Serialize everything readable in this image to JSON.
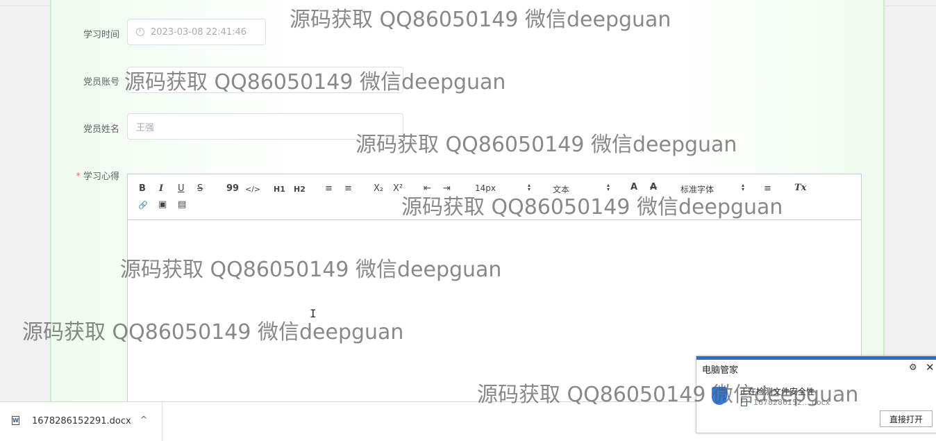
{
  "form": {
    "study_time": {
      "label": "学习时间",
      "value": "2023-03-08 22:41:46"
    },
    "member_account": {
      "label": "党员账号",
      "value": ""
    },
    "member_name": {
      "label": "党员姓名",
      "value": "王强"
    },
    "study_notes": {
      "required_mark": "*",
      "label": "学习心得"
    }
  },
  "editor": {
    "toolbar": {
      "bold": "B",
      "italic": "I",
      "underline": "U",
      "strike": "S",
      "blockquote": "99",
      "code": "</>",
      "h1": "H1",
      "h2": "H2",
      "ordered_list": "≡",
      "bullet_list": "≡",
      "subscript": "X₂",
      "superscript": "X²",
      "outdent": "⇤",
      "indent": "⇥",
      "size_picker": "14px",
      "header_picker": "文本",
      "font_picker": "标准字体",
      "color": "A",
      "background": "A",
      "align": "≡",
      "clean": "Tx",
      "link": "🔗",
      "image": "▣",
      "video": "▤"
    },
    "content": ""
  },
  "watermark_text": "源码获取 QQ86050149 微信deepguan",
  "download_bar": {
    "file_name": "1678286152291.docx",
    "chevron": "^"
  },
  "popup": {
    "title": "电脑管家",
    "status": "正在检测文件安全性",
    "file_name": "1678286152....docx",
    "open_button": "直接打开"
  },
  "colors": {
    "panel_tint": "#eefbee",
    "required": "#f56c6c",
    "popup_accent": "#1f6fd8"
  }
}
